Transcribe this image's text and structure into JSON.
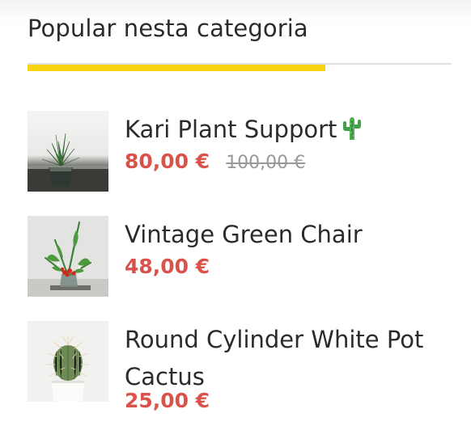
{
  "widget": {
    "title": "Popular nesta categoria",
    "accent_color": "#f7d512",
    "price_color": "#d9534a"
  },
  "products": [
    {
      "name": "Kari Plant Support",
      "name_icon": "cactus-icon",
      "thumb_icon": "succulent-in-glass-pot-image",
      "price": "80,00 €",
      "old_price": "100,00 €"
    },
    {
      "name": "Vintage Green Chair",
      "thumb_icon": "flower-arrangement-image",
      "price": "48,00 €"
    },
    {
      "name": "Round Cylinder White Pot Cactus",
      "thumb_icon": "round-cactus-in-white-pot-image",
      "price": "25,00 €"
    }
  ]
}
